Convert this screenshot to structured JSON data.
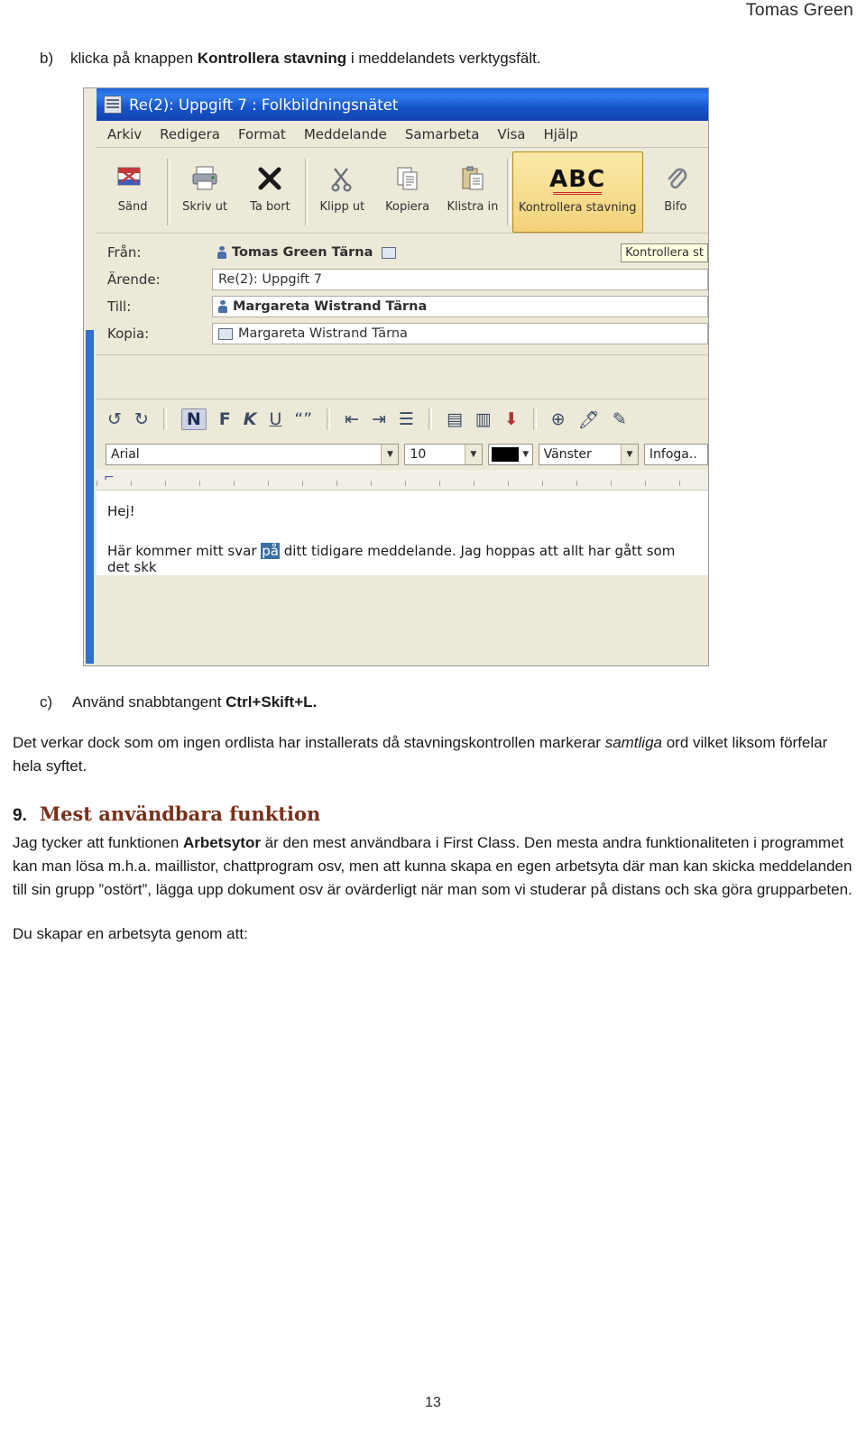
{
  "header": {
    "author": "Tomas Green"
  },
  "footer": {
    "page_number": "13"
  },
  "steps": {
    "b_marker": "b)",
    "b_text_pre": "klicka på knappen ",
    "b_text_bold": "Kontrollera stavning",
    "b_text_post": " i meddelandets verktygsfält.",
    "c_marker": "c)",
    "c_text_pre": "Använd snabbtangent ",
    "c_text_bold": "Ctrl+Skift+L."
  },
  "paragraphs": {
    "after_c": "Det verkar dock som om ingen ordlista har installerats då stavningskontrollen markerar samtliga ord vilket liksom förfelar hela syftet.",
    "after_c_italic": "samtliga",
    "section_number": "9.",
    "section_title": "Mest användbara funktion",
    "body1": "Jag tycker att funktionen Arbetsytor är den mest användbara i First Class. Den mesta andra funktionaliteten i programmet kan man lösa m.h.a. maillistor, chattprogram osv, men att kunna skapa en egen arbetsyta där man kan skicka meddelanden till sin grupp ”ostört”, lägga upp dokument osv är ovärderligt när man som vi studerar på distans och ska göra grupparbeten.",
    "body1_bold": "Arbetsytor",
    "body2": "Du skapar en arbetsyta genom att:"
  },
  "screenshot": {
    "window_title": "Re(2): Uppgift 7 : Folkbildningsnätet",
    "menus": [
      "Arkiv",
      "Redigera",
      "Format",
      "Meddelande",
      "Samarbeta",
      "Visa",
      "Hjälp"
    ],
    "toolbar": [
      {
        "label": "Sänd",
        "icon": "envelope-send-icon"
      },
      {
        "label": "Skriv ut",
        "icon": "printer-icon"
      },
      {
        "label": "Ta bort",
        "icon": "delete-x-icon"
      },
      {
        "label": "Klipp ut",
        "icon": "scissors-icon"
      },
      {
        "label": "Kopiera",
        "icon": "copy-icon"
      },
      {
        "label": "Klistra in",
        "icon": "paste-icon"
      },
      {
        "label": "Kontrollera stavning",
        "icon": "abc-spellcheck-icon"
      },
      {
        "label": "Bifo",
        "icon": "paperclip-icon"
      }
    ],
    "fields": {
      "from_label": "Från:",
      "from_value": "Tomas Green Tärna",
      "subject_label": "Ärende:",
      "subject_value": "Re(2): Uppgift 7",
      "to_label": "Till:",
      "to_value": "Margareta Wistrand Tärna",
      "cc_label": "Kopia:",
      "cc_value": "Margareta Wistrand Tärna",
      "tooltip": "Kontrollera st"
    },
    "format_toolbar": {
      "undo": "↺",
      "redo": "↻",
      "bold_n": "N",
      "italic_f": "F",
      "k": "K",
      "underline": "U",
      "quote": "“”"
    },
    "font_bar": {
      "font": "Arial",
      "size": "10",
      "color": "#000000",
      "align": "Vänster",
      "insert": "Infoga.."
    },
    "message_body": {
      "line1": "Hej!",
      "line2_pre": "Här kommer mitt svar ",
      "line2_selected": "på",
      "line2_post": " ditt tidigare meddelande. Jag hoppas att allt har gått som det skk"
    }
  }
}
